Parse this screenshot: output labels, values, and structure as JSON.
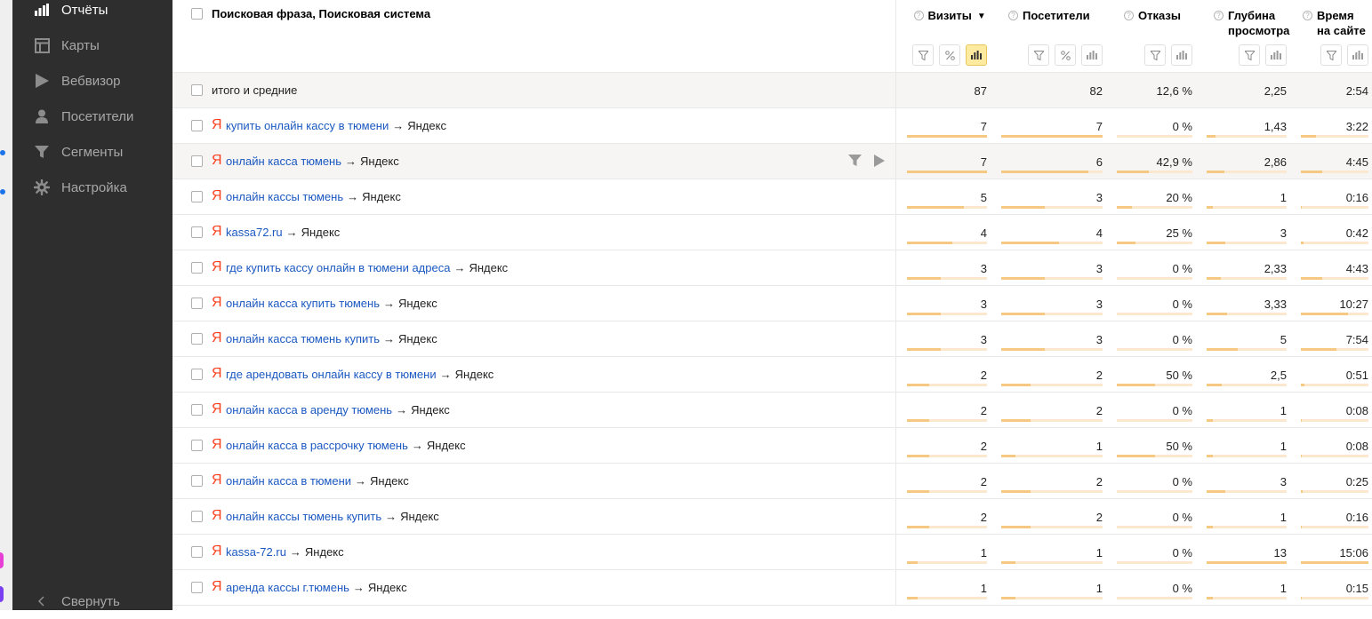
{
  "sidebar": {
    "items": [
      {
        "label": "Отчёты",
        "icon": "bar-chart-icon",
        "active": true
      },
      {
        "label": "Карты",
        "icon": "map-layout-icon",
        "active": false
      },
      {
        "label": "Вебвизор",
        "icon": "play-icon",
        "active": false
      },
      {
        "label": "Посетители",
        "icon": "person-icon",
        "active": false
      },
      {
        "label": "Сегменты",
        "icon": "funnel-icon",
        "active": false
      },
      {
        "label": "Настройка",
        "icon": "gear-icon",
        "active": false
      }
    ],
    "collapse_label": "Свернуть"
  },
  "table": {
    "dimension_header": "Поисковая фраза, Поисковая система",
    "metrics": [
      {
        "key": "visits",
        "label": "Визиты",
        "sorted": true,
        "sort_arrow": "▼",
        "percent_tool": true,
        "chart_active": true,
        "max": 7
      },
      {
        "key": "visitors",
        "label": "Посетители",
        "sorted": false,
        "percent_tool": true,
        "chart_active": false,
        "max": 7
      },
      {
        "key": "bounce",
        "label": "Отказы",
        "sorted": false,
        "percent_tool": false,
        "chart_active": false,
        "max": 100
      },
      {
        "key": "depth",
        "label": "Глубина просмотра",
        "sorted": false,
        "percent_tool": false,
        "chart_active": false,
        "max": 13
      },
      {
        "key": "time",
        "label": "Время на сайте",
        "sorted": false,
        "percent_tool": false,
        "chart_active": false,
        "max": 906
      }
    ],
    "totals": {
      "label": "итого и средние",
      "values": [
        "87",
        "82",
        "12,6 %",
        "2,25",
        "2:54"
      ]
    },
    "rows": [
      {
        "phrase": "купить онлайн кассу в тюмени",
        "engine": "Яндекс",
        "values": [
          "7",
          "7",
          "0 %",
          "1,43",
          "3:22"
        ],
        "numeric": [
          7,
          7,
          0,
          1.43,
          202
        ]
      },
      {
        "phrase": "онлайн касса тюмень",
        "engine": "Яндекс",
        "values": [
          "7",
          "6",
          "42,9 %",
          "2,86",
          "4:45"
        ],
        "numeric": [
          7,
          6,
          42.9,
          2.86,
          285
        ],
        "hover": true
      },
      {
        "phrase": "онлайн кассы тюмень",
        "engine": "Яндекс",
        "values": [
          "5",
          "3",
          "20 %",
          "1",
          "0:16"
        ],
        "numeric": [
          5,
          3,
          20,
          1,
          16
        ]
      },
      {
        "phrase": "kassa72.ru",
        "engine": "Яндекс",
        "values": [
          "4",
          "4",
          "25 %",
          "3",
          "0:42"
        ],
        "numeric": [
          4,
          4,
          25,
          3,
          42
        ]
      },
      {
        "phrase": "где купить кассу онлайн в тюмени адреса",
        "engine": "Яндекс",
        "values": [
          "3",
          "3",
          "0 %",
          "2,33",
          "4:43"
        ],
        "numeric": [
          3,
          3,
          0,
          2.33,
          283
        ]
      },
      {
        "phrase": "онлайн касса купить тюмень",
        "engine": "Яндекс",
        "values": [
          "3",
          "3",
          "0 %",
          "3,33",
          "10:27"
        ],
        "numeric": [
          3,
          3,
          0,
          3.33,
          627
        ]
      },
      {
        "phrase": "онлайн касса тюмень купить",
        "engine": "Яндекс",
        "values": [
          "3",
          "3",
          "0 %",
          "5",
          "7:54"
        ],
        "numeric": [
          3,
          3,
          0,
          5,
          474
        ]
      },
      {
        "phrase": "где арендовать онлайн кассу в тюмени",
        "engine": "Яндекс",
        "values": [
          "2",
          "2",
          "50 %",
          "2,5",
          "0:51"
        ],
        "numeric": [
          2,
          2,
          50,
          2.5,
          51
        ]
      },
      {
        "phrase": "онлайн касса в аренду тюмень",
        "engine": "Яндекс",
        "values": [
          "2",
          "2",
          "0 %",
          "1",
          "0:08"
        ],
        "numeric": [
          2,
          2,
          0,
          1,
          8
        ]
      },
      {
        "phrase": "онлайн касса в рассрочку тюмень",
        "engine": "Яндекс",
        "values": [
          "2",
          "1",
          "50 %",
          "1",
          "0:08"
        ],
        "numeric": [
          2,
          1,
          50,
          1,
          8
        ]
      },
      {
        "phrase": "онлайн касса в тюмени",
        "engine": "Яндекс",
        "values": [
          "2",
          "2",
          "0 %",
          "3",
          "0:25"
        ],
        "numeric": [
          2,
          2,
          0,
          3,
          25
        ]
      },
      {
        "phrase": "онлайн кассы тюмень купить",
        "engine": "Яндекс",
        "values": [
          "2",
          "2",
          "0 %",
          "1",
          "0:16"
        ],
        "numeric": [
          2,
          2,
          0,
          1,
          16
        ]
      },
      {
        "phrase": "kassa-72.ru",
        "engine": "Яндекс",
        "values": [
          "1",
          "1",
          "0 %",
          "13",
          "15:06"
        ],
        "numeric": [
          1,
          1,
          0,
          13,
          906
        ]
      },
      {
        "phrase": "аренда кассы г.тюмень",
        "engine": "Яндекс",
        "values": [
          "1",
          "1",
          "0 %",
          "1",
          "0:15"
        ],
        "numeric": [
          1,
          1,
          0,
          1,
          15
        ]
      }
    ]
  },
  "colors": {
    "sidebar_bg": "#2e2e2e",
    "link": "#1b59c1",
    "yandex_red": "#fc3f1d",
    "bar_fill": "#f5c982",
    "bar_track": "#fbe8cf",
    "active_tool": "#ffeba0"
  }
}
